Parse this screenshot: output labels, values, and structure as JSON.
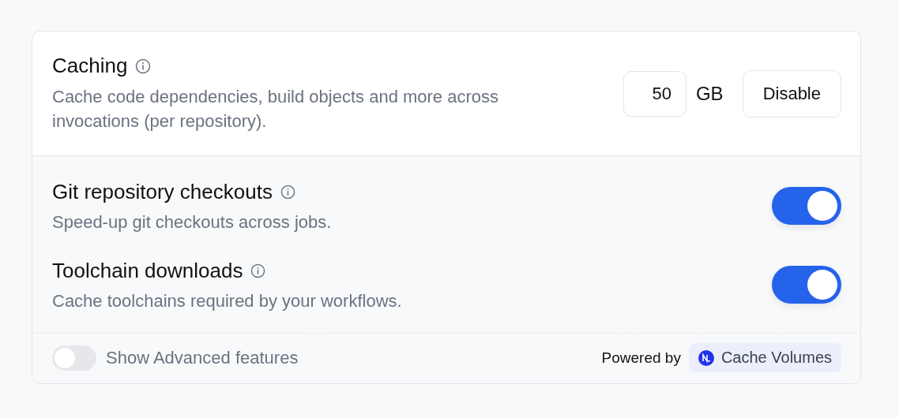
{
  "caching": {
    "title": "Caching",
    "description": "Cache code dependencies, build objects and more across invocations (per repository).",
    "size_value": "50",
    "size_unit": "GB",
    "button": "Disable"
  },
  "features": [
    {
      "title": "Git repository checkouts",
      "description": "Speed-up git checkouts across jobs.",
      "on": true
    },
    {
      "title": "Toolchain downloads",
      "description": "Cache toolchains required by your workflows.",
      "on": true
    }
  ],
  "footer": {
    "advanced": {
      "label": "Show Advanced features",
      "on": false
    },
    "powered_by": "Powered by",
    "provider": "Cache Volumes"
  }
}
